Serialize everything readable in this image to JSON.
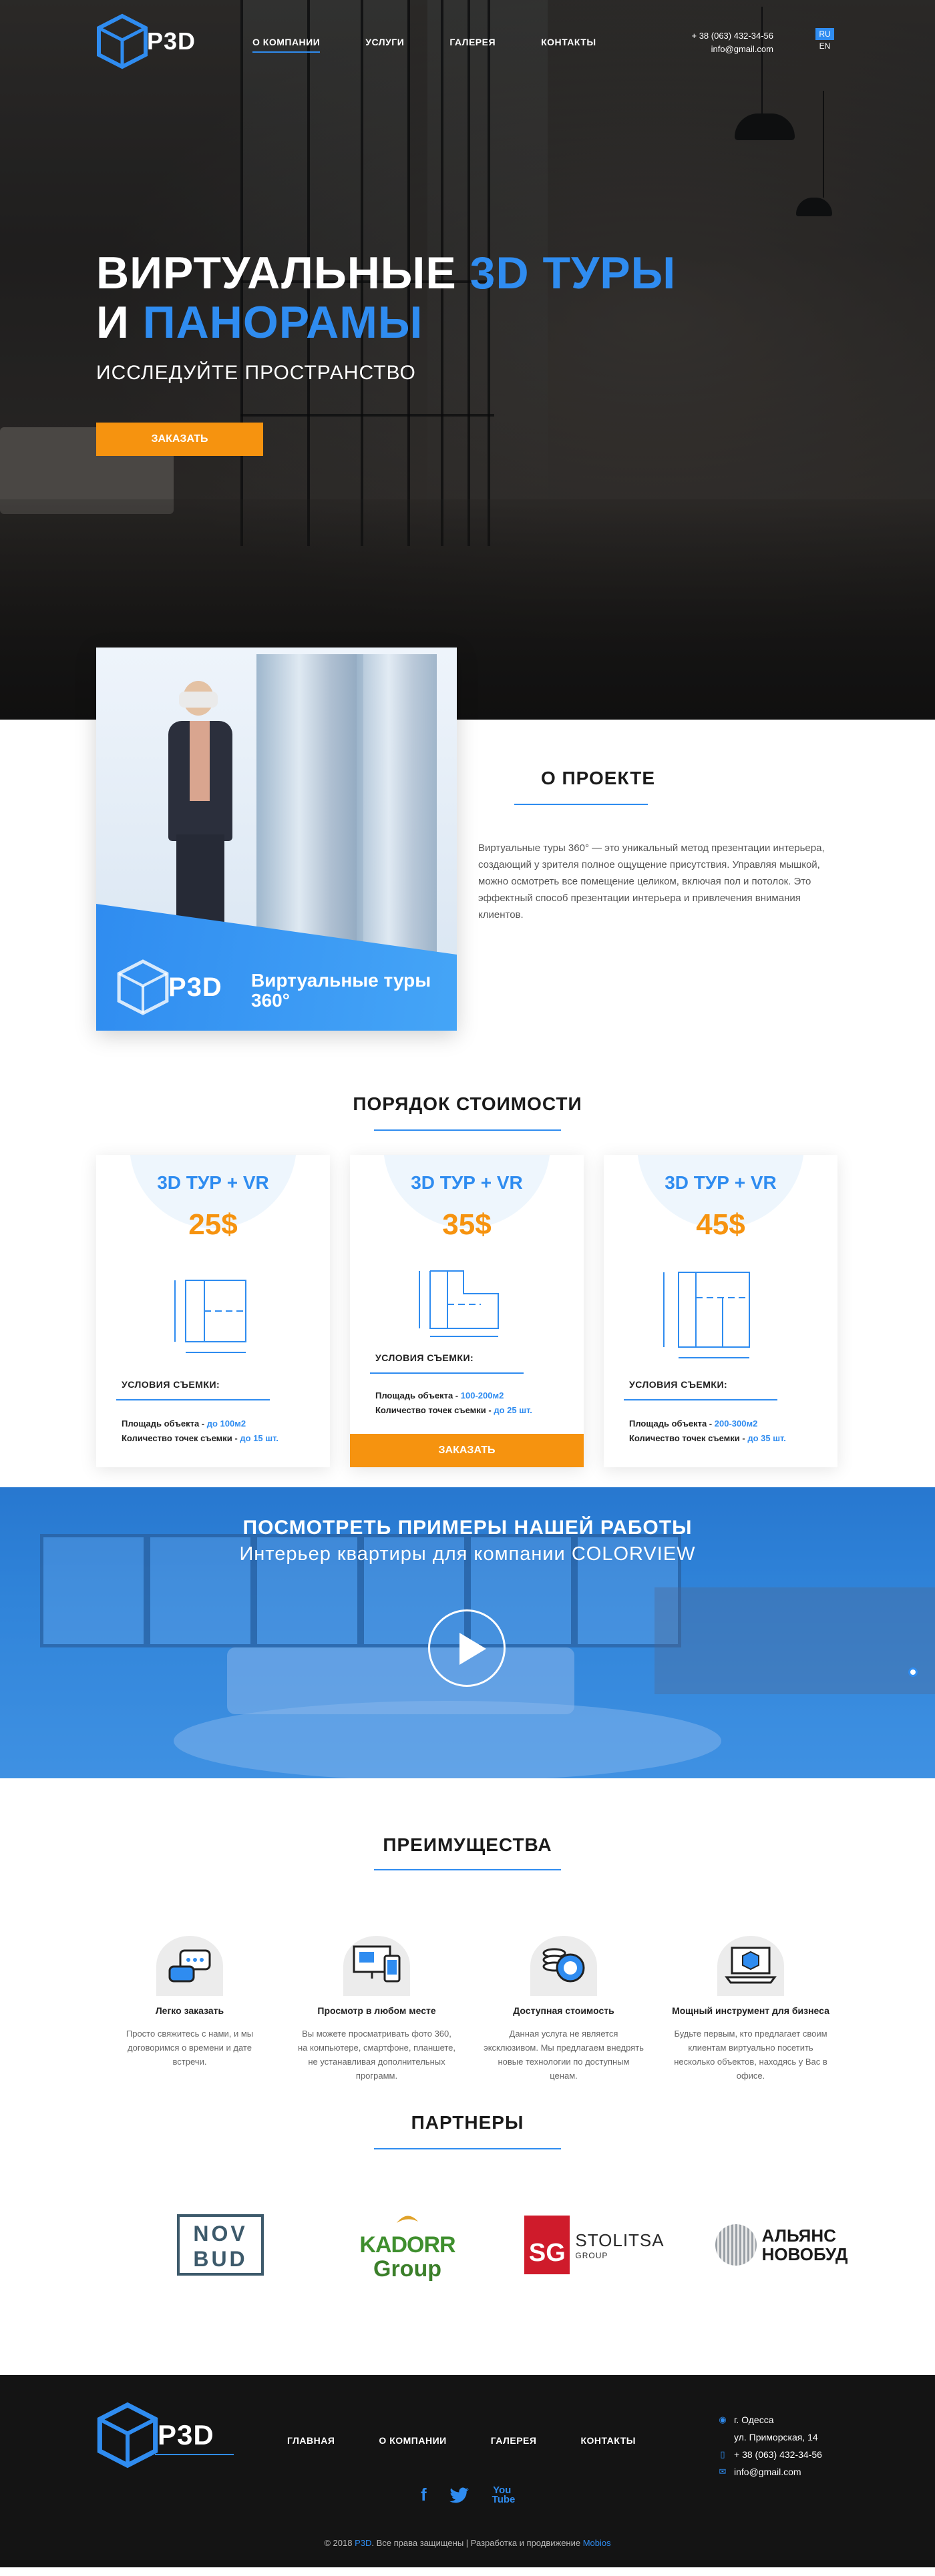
{
  "brand": {
    "logo_main": "P",
    "logo_accent": "3D"
  },
  "nav": {
    "items": [
      "О КОМПАНИИ",
      "УСЛУГИ",
      "ГАЛЕРЕЯ",
      "КОНТАКТЫ"
    ],
    "phone": "+ 38 (063) 432-34-56",
    "email": "info@gmail.com",
    "lang_ru": "RU",
    "lang_en": "EN"
  },
  "hero": {
    "title_white_1": "ВИРТУАЛЬНЫЕ ",
    "title_blue_1": "3D ТУРЫ",
    "title_white_2": "И ",
    "title_blue_2": "ПАНОРАМЫ",
    "subtitle": "ИССЛЕДУЙТЕ ПРОСТРАНСТВО",
    "button": "ЗАКАЗАТЬ"
  },
  "about": {
    "image_caption_1": "Виртуальные туры",
    "image_caption_2": "360°",
    "title": "О ПРОЕКТЕ",
    "text": "Виртуальные туры 360° — это уникальный метод презентации интерьера, создающий у зрителя полное ощущение присутствия. Управляя мышкой, можно осмотреть все помещение целиком, включая пол и потолок. Это эффектный способ презентации интерьера и привлечения внимания клиентов."
  },
  "pricing": {
    "title": "ПОРЯДОК СТОИМОСТИ",
    "cards": [
      {
        "title": "3D ТУР + VR",
        "price": "25$",
        "conditions": "УСЛОВИЯ СЪЕМКИ:",
        "area_label": "Площадь объекта - ",
        "area_value": "до 100м2",
        "points_label": "Количество точек съемки - ",
        "points_value": "до 15 шт."
      },
      {
        "title": "3D ТУР + VR",
        "price": "35$",
        "conditions": "УСЛОВИЯ СЪЕМКИ:",
        "area_label": "Площадь объекта - ",
        "area_value": "100-200м2",
        "points_label": "Количество точек съемки - ",
        "points_value": "до 25 шт.",
        "button": "ЗАКАЗАТЬ"
      },
      {
        "title": "3D ТУР + VR",
        "price": "45$",
        "conditions": "УСЛОВИЯ СЪЕМКИ:",
        "area_label": "Площадь объекта - ",
        "area_value": "200-300м2",
        "points_label": "Количество точек съемки - ",
        "points_value": "до 35 шт."
      }
    ]
  },
  "video": {
    "title": "ПОСМОТРЕТЬ ПРИМЕРЫ НАШЕЙ РАБОТЫ",
    "subtitle": "Интерьер квартиры для компании COLORVIEW"
  },
  "advantages": {
    "title": "ПРЕИМУЩЕСТВА",
    "items": [
      {
        "icon": "chat-icon",
        "name": "Легко заказать",
        "desc": "Просто свяжитесь с нами, и мы договоримся о времени и дате встречи."
      },
      {
        "icon": "devices-icon",
        "name": "Просмотр в любом месте",
        "desc": "Вы можете просматривать фото 360, на компьютере, смартфоне, планшете, не устанавливая дополнительных программ."
      },
      {
        "icon": "coins-icon",
        "name": "Доступная стоимость",
        "desc": "Данная услуга не является эксклюзивом. Мы предлагаем внедрять новые технологии по доступным ценам."
      },
      {
        "icon": "laptop-cube-icon",
        "name": "Мощный инструмент для бизнеса",
        "desc": "Будьте первым, кто предлагает своим клиентам виртуально посетить несколько объектов, находясь у Вас в офисе."
      }
    ]
  },
  "partners": {
    "title": "ПАРТНЕРЫ",
    "novbud_1": "NOV",
    "novbud_2": "BUD",
    "kadorr_1": "KADORR",
    "kadorr_2": "Group",
    "sg_box": "SG",
    "sg_name": "STOLITSA",
    "sg_group": "GROUP",
    "alz_1": "АЛЬЯНС",
    "alz_2": "НОВОБУД"
  },
  "footer": {
    "menu": [
      "ГЛАВНАЯ",
      "О КОМПАНИИ",
      "ГАЛЕРЕЯ",
      "КОНТАКТЫ"
    ],
    "city": "г. Одесса",
    "street": "ул. Приморская, 14",
    "phone": "+ 38 (063) 432-34-56",
    "email": "info@gmail.com",
    "social": [
      "f",
      "twitter",
      "You Tube"
    ],
    "copy_1": "© 2018 ",
    "copy_brand": "P3D",
    "copy_2": ". Все права защищены | Разработка и продвижение ",
    "copy_dev": "Mobios"
  },
  "colors": {
    "accent": "#2f8cf0",
    "orange": "#f6930f",
    "footer_bg": "#141414"
  }
}
